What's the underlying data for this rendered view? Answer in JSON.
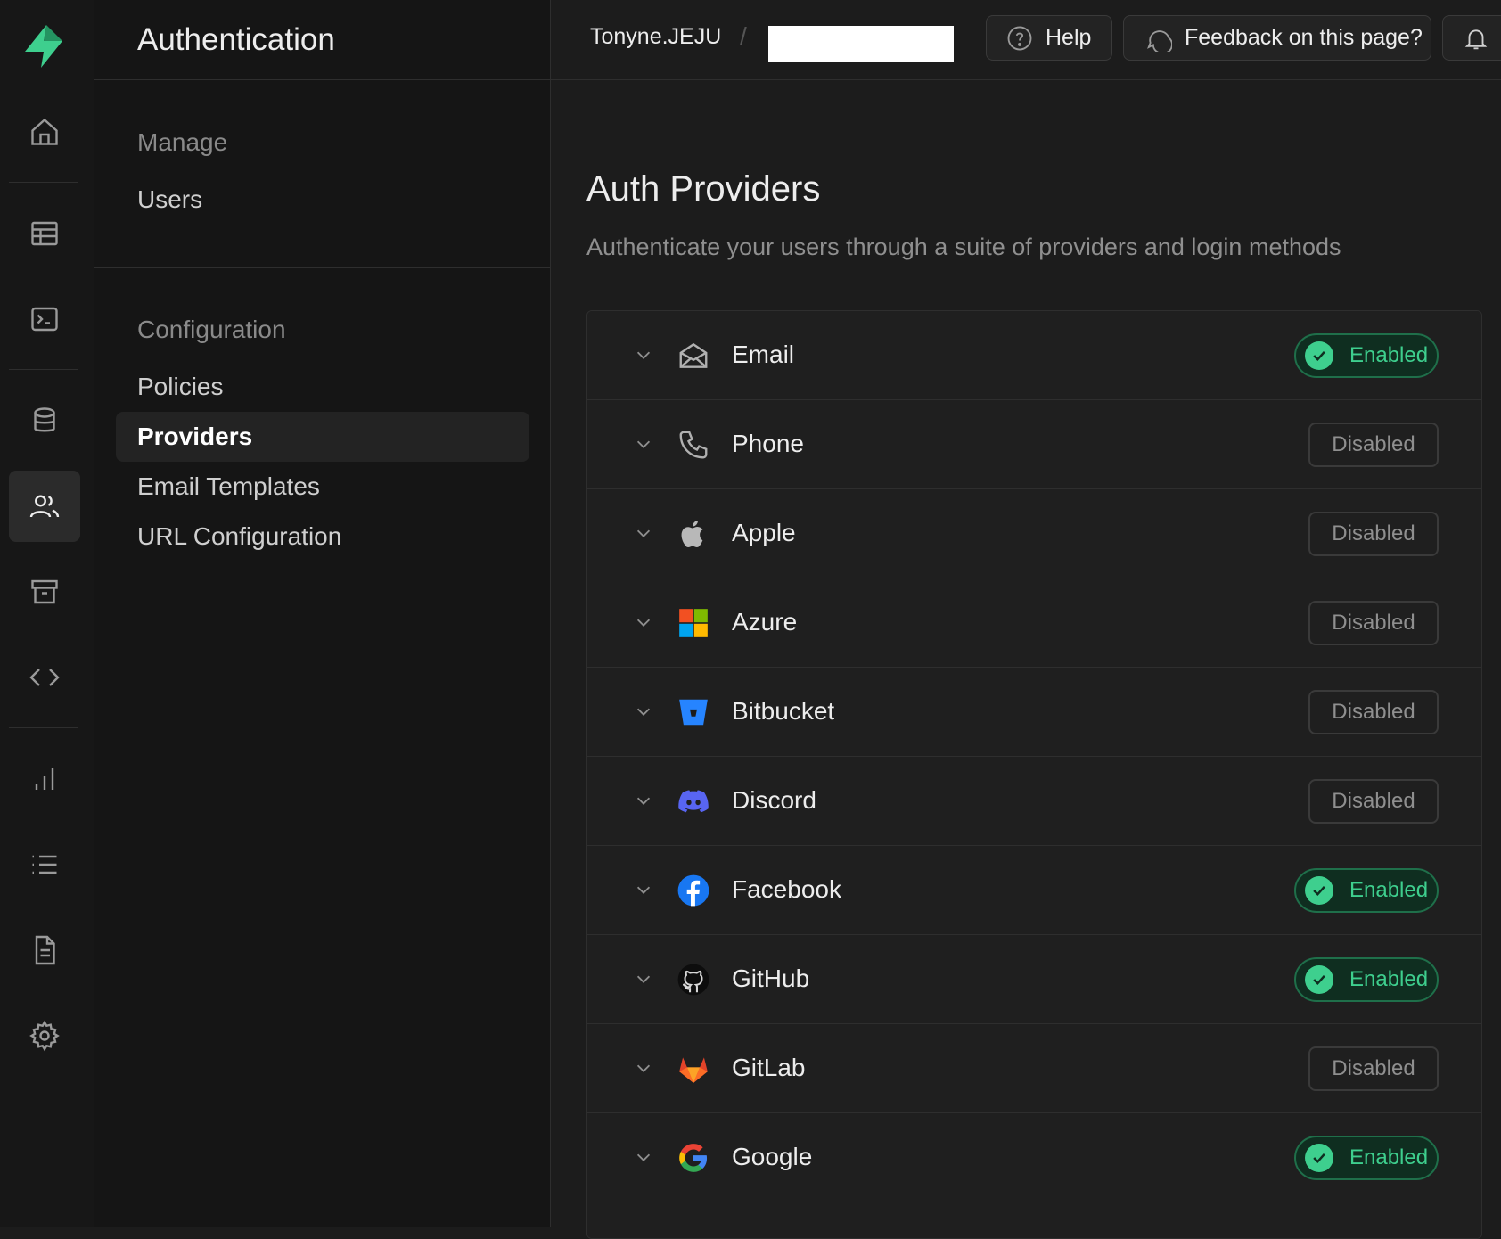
{
  "sidebar_title": "Authentication",
  "breadcrumb": {
    "org": "Tonyne.JEJU",
    "separator": "/"
  },
  "topbar": {
    "help": "Help",
    "feedback": "Feedback on this page?"
  },
  "menu": {
    "manage_heading": "Manage",
    "users": "Users",
    "configuration_heading": "Configuration",
    "policies": "Policies",
    "providers": "Providers",
    "email_templates": "Email Templates",
    "url_configuration": "URL Configuration"
  },
  "page": {
    "title": "Auth Providers",
    "subtitle": "Authenticate your users through a suite of providers and login methods"
  },
  "providers": [
    {
      "name": "Email",
      "status": "Enabled"
    },
    {
      "name": "Phone",
      "status": "Disabled"
    },
    {
      "name": "Apple",
      "status": "Disabled"
    },
    {
      "name": "Azure",
      "status": "Disabled"
    },
    {
      "name": "Bitbucket",
      "status": "Disabled"
    },
    {
      "name": "Discord",
      "status": "Disabled"
    },
    {
      "name": "Facebook",
      "status": "Enabled"
    },
    {
      "name": "GitHub",
      "status": "Enabled"
    },
    {
      "name": "GitLab",
      "status": "Disabled"
    },
    {
      "name": "Google",
      "status": "Enabled"
    }
  ],
  "colors": {
    "accent": "#3ecf8e",
    "background": "#1c1c1c"
  }
}
